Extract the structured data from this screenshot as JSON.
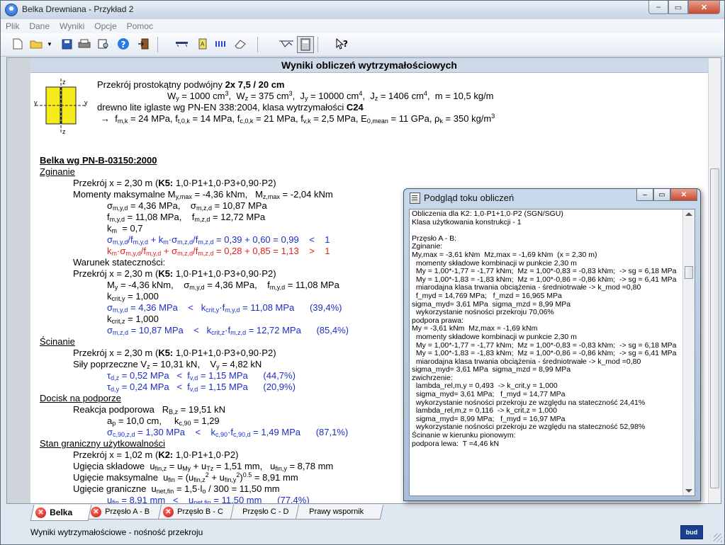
{
  "window": {
    "title": "Belka Drewniana - Przykład 2"
  },
  "menu": [
    "Plik",
    "Dane",
    "Wyniki",
    "Opcje",
    "Pomoc"
  ],
  "results_title": "Wyniki obliczeń wytrzymałościowych",
  "section": {
    "line1_prefix": "Przekrój prostokątny podwójny ",
    "line1_bold": "2x 7,5 / 20 cm",
    "props": {
      "Wy": "1000 cm",
      "Wz": "375 cm",
      "Jy": "10000 cm",
      "Jz": "1406 cm",
      "m": "10,5 kg/m"
    },
    "material_prefix": "drewno lite iglaste wg PN-EN 338:2004, klasa wytrzymałości ",
    "material_class": "C24",
    "strengths": {
      "fmk": "24 MPa",
      "ft0k": "14 MPa",
      "fc0k": "21 MPa",
      "fvk": "2,5 MPa",
      "E0mean": "11 GPa",
      "rhok": "350 kg/m"
    }
  },
  "main_heading": "Belka wg PN-B-03150:2000 ",
  "bending": {
    "heading": "Zginanie",
    "section_x": "2,30 m",
    "comb_bold": "K5:",
    "comb": " 1,0·P1+1,0·P3+0,90·P2)",
    "moments": "Momenty maksymalne M",
    "my": "-4,36 kNm",
    "mz": "-2,04 kNm",
    "smyd": "4,36 MPa",
    "smzd": "10,87 MPa",
    "fmyd": "11,08 MPa",
    "fmzd": "12,72 MPa",
    "km": "0,7",
    "check1": "0,39 + 0,60 = 0,99",
    "check1_rel": "<",
    "check1_lim": "1",
    "check2": "0,28 + 0,85 = 1,13",
    "check2_rel": ">",
    "check2_lim": "1"
  },
  "stability": {
    "heading": "Warunek stateczności:",
    "my": "-4,36 kNm",
    "smyd": "4,36 MPa",
    "fmyd": "11,08 MPa",
    "kcrity": "1,000",
    "check_y": "4,36 MPa",
    "check_y_lim": "11,08 MPa",
    "check_y_pct": "(39,4%)",
    "kcritz": "1,000",
    "check_z": "10,87 MPa",
    "check_z_lim": "12,72 MPa",
    "check_z_pct": "(85,4%)"
  },
  "shear": {
    "heading": "Ścinanie",
    "forces_label": "Siły poprzeczne V",
    "vz": "10,31 kN",
    "vy": "4,82 kN",
    "tdz": "0,52 MPa",
    "fvd": "1,15 MPa",
    "pct_z": "(44,7%)",
    "tdy": "0,24 MPa",
    "pct_y": "(20,9%)"
  },
  "bearing": {
    "heading": "Docisk na podporze",
    "reaction_label": "Reakcja podporowa",
    "rbz": "19,51 kN",
    "ap": "10,0 cm",
    "kc90": "1,29",
    "sc90": "1,30 MPa",
    "lim": "1,49 MPa",
    "pct": "(87,1%)"
  },
  "sls": {
    "heading": "Stan graniczny użytkowalności",
    "section_x": "1,02 m",
    "comb_bold": "K2:",
    "comb": " 1,0·P1+1,0·P2)",
    "ufinz": "1,51 mm",
    "ufiny": "8,78 mm",
    "ufin": "8,91 mm",
    "unetfin": "11,50 mm",
    "ufin_check": "8,91 mm",
    "unet_check": "11,50 mm",
    "pct": "(77,4%)"
  },
  "tabs": [
    {
      "label": "Belka",
      "error": true
    },
    {
      "label": "Przęsło A - B",
      "error": true
    },
    {
      "label": "Przęsło B - C",
      "error": true
    },
    {
      "label": "Przęsło C - D",
      "error": false
    },
    {
      "label": "Prawy wspornik",
      "error": false
    }
  ],
  "status": "Wyniki wytrzymałościowe - nośność przekroju",
  "logo": "bud",
  "popup": {
    "title": "Podgląd toku obliczeń",
    "lines": [
      "Obliczenia dla K2: 1,0·P1+1,0·P2 (SGN/SGU)",
      "Klasa użytkowania konstrukcji - 1",
      "",
      "Przęsło A - B:",
      "Zginanie:",
      "My,max = -3,61 kNm  Mz,max = -1,69 kNm  (x = 2,30 m)",
      "  momenty składowe kombinacji w punkcie 2,30 m",
      "  My = 1,00*-1,77 = -1,77 kNm;  Mz = 1,00*-0,83 = -0,83 kNm;  -> sg = 6,18 MPa",
      "  My = 1,00*-1,83 = -1,83 kNm;  Mz = 1,00*-0,86 = -0,86 kNm;  -> sg = 6,41 MPa",
      "  miarodajna klasa trwania obciążenia - średniotrwałe -> k_mod =0,80",
      "  f_myd = 14,769 MPa;   f_mzd = 16,965 MPa",
      "sigma_myd= 3,61 MPa  sigma_mzd = 8,99 MPa",
      "  wykorzystanie nośności przekroju 70,06%",
      "podpora prawa:",
      "My = -3,61 kNm  Mz,max = -1,69 kNm",
      "  momenty składowe kombinacji w punkcie 2,30 m",
      "  My = 1,00*-1,77 = -1,77 kNm;  Mz = 1,00*-0,83 = -0,83 kNm;  -> sg = 6,18 MPa",
      "  My = 1,00*-1,83 = -1,83 kNm;  Mz = 1,00*-0,86 = -0,86 kNm;  -> sg = 6,41 MPa",
      "  miarodajna klasa trwania obciążenia - średniotrwałe -> k_mod =0,80",
      "sigma_myd= 3,61 MPa  sigma_mzd = 8,99 MPa",
      "zwichrzenie:",
      "  lambda_rel,m,y = 0,493  -> k_crit,y = 1,000",
      "  sigma_myd= 3,61 MPa;   f_myd = 14,77 MPa",
      "  wykorzystanie nośności przekroju ze względu na stateczność 24,41%",
      "  lambda_rel,m,z = 0,116  -> k_crit,z = 1,000",
      "  sigma_myd= 8,99 MPa;   f_myd = 16,97 MPa",
      "  wykorzystanie nośności przekroju ze względu na stateczność 52,98%",
      "Ścinanie w kierunku pionowym:",
      "podpora lewa:  T =4,46 kN"
    ]
  }
}
